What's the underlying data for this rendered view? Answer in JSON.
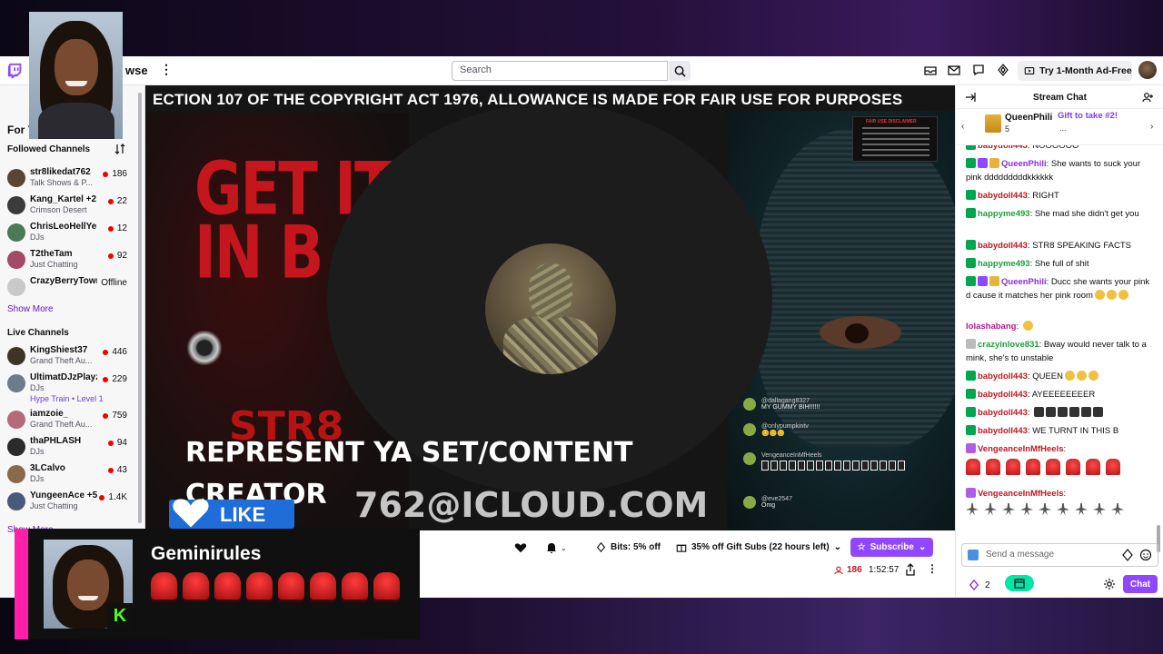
{
  "topnav": {
    "browse_label": "wse",
    "search_placeholder": "Search",
    "ad_free_label": "Try 1-Month Ad-Free",
    "brand_color": "#9147ff"
  },
  "sidebar": {
    "for_you": "For Y",
    "followed_title": "Followed Channels",
    "followed": [
      {
        "name": "str8likedat762",
        "category": "Talk Shows & P...",
        "viewers": "186",
        "avatar": "#5a4433"
      },
      {
        "name": "Kang_Kartel +2",
        "category": "Crimson Desert",
        "viewers": "22",
        "avatar": "#3b3b3b"
      },
      {
        "name": "ChrisLeoHellYe...",
        "category": "DJs",
        "viewers": "12",
        "avatar": "#4c7a56"
      },
      {
        "name": "T2theTam",
        "category": "Just Chatting",
        "viewers": "92",
        "avatar": "#a34a66"
      },
      {
        "name": "CrazyBerryTown",
        "category": "",
        "viewers": "Offline",
        "avatar": "#c9c9c9"
      }
    ],
    "show_more": "Show More",
    "live_title": "Live Channels",
    "live": [
      {
        "name": "KingShiest37",
        "category": "Grand Theft Au...",
        "viewers": "446",
        "avatar": "#3d3428"
      },
      {
        "name": "UltimatDJzPlayz",
        "category": "DJs",
        "viewers": "229",
        "avatar": "#6f7b8a",
        "hype": "Hype Train • Level 1"
      },
      {
        "name": "iamzoie_",
        "category": "Grand Theft Au...",
        "viewers": "759",
        "avatar": "#b36a7a"
      },
      {
        "name": "thaPHLASH",
        "category": "DJs",
        "viewers": "94",
        "avatar": "#2b2b2b"
      },
      {
        "name": "3LCalvo",
        "category": "DJs",
        "viewers": "43",
        "avatar": "#8a6a4a"
      },
      {
        "name": "YungeenAce +5",
        "category": "Just Chatting",
        "viewers": "1.4K",
        "avatar": "#4a5a7a"
      }
    ],
    "show_more_2": "Show More"
  },
  "player": {
    "ticker": "ECTION 107 OF THE COPYRIGHT ACT 1976, ALLOWANCE IS MADE FOR FAIR USE FOR PURPOSES",
    "art_text_1": "GET IT",
    "art_text_2": "IN B",
    "art_text_3": "STR8",
    "disclaimer_title": "FAIR USE DISCLAIMER",
    "represent": "REPRESENT YA SET/CONTENT CREATOR",
    "email": "762@ICLOUD.COM",
    "like_label": "LIKE",
    "overlay_chat": [
      {
        "user": "@dallagang8327",
        "text": "MY GUMMY BIH!!!!!!"
      },
      {
        "user": "@onlypumpkintv",
        "text": "😊😊😊"
      },
      {
        "user": "VengeanceInMfHeels",
        "text": ""
      },
      {
        "user": "@eve2547",
        "text": "Omg"
      }
    ]
  },
  "infobar": {
    "bits": "Bits: 5% off",
    "gift_subs": "35% off Gift Subs (22 hours left)",
    "subscribe": "Subscribe",
    "viewers": "186",
    "uptime": "1:52:57"
  },
  "chat": {
    "title": "Stream Chat",
    "gift": {
      "name": "QueenPhili",
      "count": "5",
      "action": "Gift to take #2!",
      "more": "..."
    },
    "messages": [
      {
        "user": "babydoll443",
        "color": "#c4161c",
        "text": "NOOOOOO",
        "badges": [
          "green"
        ]
      },
      {
        "user": "QueenPhili",
        "color": "#8a2be2",
        "text": "She wants to suck your pink dddddddddkkkkkk",
        "badges": [
          "green",
          "purple",
          "gold"
        ]
      },
      {
        "user": "babydoll443",
        "color": "#c4161c",
        "text": "RIGHT",
        "badges": [
          "green"
        ]
      },
      {
        "user": "happyme493",
        "color": "#1e9e3a",
        "text": "She mad she didn't get you",
        "badges": [
          "green"
        ]
      },
      {
        "user": "babydoll443",
        "color": "#c4161c",
        "text": "STR8 SPEAKING FACTS",
        "badges": [
          "green"
        ]
      },
      {
        "user": "happyme493",
        "color": "#1e9e3a",
        "text": "She full of shit",
        "badges": [
          "green"
        ]
      },
      {
        "user": "QueenPhili",
        "color": "#8a2be2",
        "text": "Ducc she wants your pink d cause it matches her pink room",
        "badges": [
          "green",
          "purple",
          "gold"
        ]
      },
      {
        "user": "lolashabang",
        "color": "#b0188a",
        "text": "",
        "badges": []
      },
      {
        "user": "crazyinlove831",
        "color": "#1e9e3a",
        "text": "Bway would never talk to a mink, she's to unstable",
        "badges": [
          "gray"
        ]
      },
      {
        "user": "babydoll443",
        "color": "#c4161c",
        "text": "QUEEN",
        "badges": [
          "green"
        ]
      },
      {
        "user": "babydoll443",
        "color": "#c4161c",
        "text": "AYEEEEEEEER",
        "badges": [
          "green"
        ]
      },
      {
        "user": "babydoll443",
        "color": "#c4161c",
        "text": "",
        "badges": [
          "green"
        ]
      },
      {
        "user": "babydoll443",
        "color": "#c4161c",
        "text": "WE TURNT IN THIS B",
        "badges": [
          "green"
        ]
      },
      {
        "user": "VengeanceInMfHeels",
        "color": "#c4161c",
        "text": "",
        "badges": [
          "violet"
        ]
      },
      {
        "user": "VengeanceInMfHeels",
        "color": "#c4161c",
        "text": "",
        "badges": [
          "violet"
        ]
      }
    ],
    "input_placeholder": "Send a message",
    "points": "2",
    "chat_button": "Chat"
  },
  "overlay": {
    "streamer_name": "Geminirules",
    "accent": "#ff1fa8"
  }
}
